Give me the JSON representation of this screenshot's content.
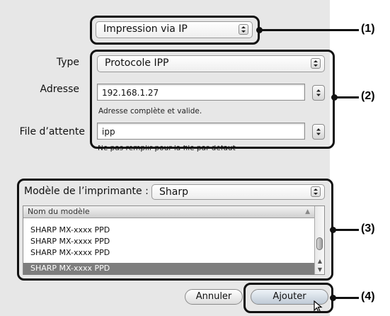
{
  "connection_popup": {
    "value": "Impression via IP"
  },
  "type": {
    "label": "Type",
    "value": "Protocole IPP"
  },
  "address": {
    "label": "Adresse",
    "value": "192.168.1.27",
    "hint": "Adresse complète et valide."
  },
  "queue": {
    "label": "File d’attente",
    "value": "ipp",
    "hint": "Ne pas remplir pour la file par défaut"
  },
  "model": {
    "label": "Modèle de l’imprimante :",
    "value": "Sharp",
    "column_header": "Nom du modèle",
    "rows": [
      "SHARP MX-xxxx PPD",
      "SHARP MX-xxxx PPD",
      "SHARP MX-xxxx PPD",
      "SHARP MX-xxxx PPD"
    ]
  },
  "buttons": {
    "cancel": "Annuler",
    "add": "Ajouter"
  },
  "callouts": [
    "(1)",
    "(2)",
    "(3)",
    "(4)"
  ],
  "icons": {
    "stepper": "up-down-arrows-icon",
    "cursor": "mouse-pointer-icon"
  }
}
